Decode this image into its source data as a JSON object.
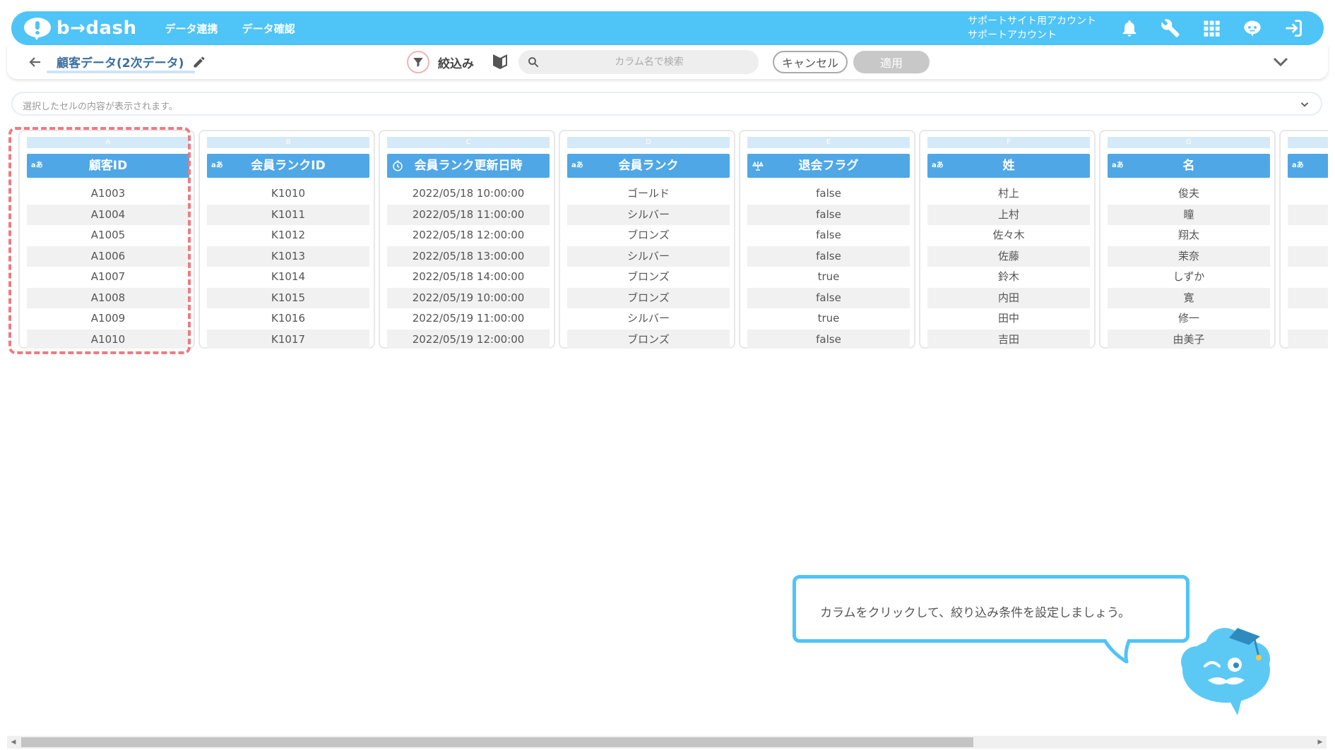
{
  "header": {
    "logo_text": "b→dash",
    "nav": [
      "データ連携",
      "データ確認"
    ],
    "account_line1": "サポートサイト用アカウント",
    "account_line2": "サポートアカウント",
    "icons": [
      "bell-icon",
      "wrench-icon",
      "apps-grid-icon",
      "helper-character-icon",
      "logout-icon"
    ],
    "accent_color": "#4fc4f7"
  },
  "toolbar": {
    "title": "顧客データ(2次データ)",
    "filter_label": "絞込み",
    "search_placeholder": "カラム名で検索",
    "cancel_label": "キャンセル",
    "apply_label": "適用"
  },
  "cell_viewer": {
    "placeholder": "選択したセルの内容が表示されます。"
  },
  "columns": [
    {
      "letter": "A",
      "type": "aあ",
      "name": "顧客ID",
      "values": [
        "A1003",
        "A1004",
        "A1005",
        "A1006",
        "A1007",
        "A1008",
        "A1009",
        "A1010"
      ]
    },
    {
      "letter": "B",
      "type": "aあ",
      "name": "会員ランクID",
      "values": [
        "K1010",
        "K1011",
        "K1012",
        "K1013",
        "K1014",
        "K1015",
        "K1016",
        "K1017"
      ]
    },
    {
      "letter": "C",
      "type": "clock",
      "name": "会員ランク更新日時",
      "values": [
        "2022/05/18 10:00:00",
        "2022/05/18 11:00:00",
        "2022/05/18 12:00:00",
        "2022/05/18 13:00:00",
        "2022/05/18 14:00:00",
        "2022/05/19 10:00:00",
        "2022/05/19 11:00:00",
        "2022/05/19 12:00:00"
      ]
    },
    {
      "letter": "D",
      "type": "aあ",
      "name": "会員ランク",
      "values": [
        "ゴールド",
        "シルバー",
        "ブロンズ",
        "シルバー",
        "ブロンズ",
        "ブロンズ",
        "シルバー",
        "ブロンズ"
      ]
    },
    {
      "letter": "E",
      "type": "flag",
      "name": "退会フラグ",
      "values": [
        "false",
        "false",
        "false",
        "false",
        "true",
        "false",
        "true",
        "false"
      ]
    },
    {
      "letter": "F",
      "type": "aあ",
      "name": "姓",
      "values": [
        "村上",
        "上村",
        "佐々木",
        "佐藤",
        "鈴木",
        "内田",
        "田中",
        "吉田"
      ]
    },
    {
      "letter": "G",
      "type": "aあ",
      "name": "名",
      "values": [
        "俊夫",
        "瞳",
        "翔太",
        "茉奈",
        "しずか",
        "寛",
        "修一",
        "由美子"
      ]
    },
    {
      "letter": "",
      "type": "aあ",
      "name": "",
      "values": [
        "",
        "",
        "",
        "",
        "",
        "",
        "",
        ""
      ]
    }
  ],
  "tooltip": {
    "text": "カラムをクリックして、絞り込み条件を設定しましょう。"
  }
}
